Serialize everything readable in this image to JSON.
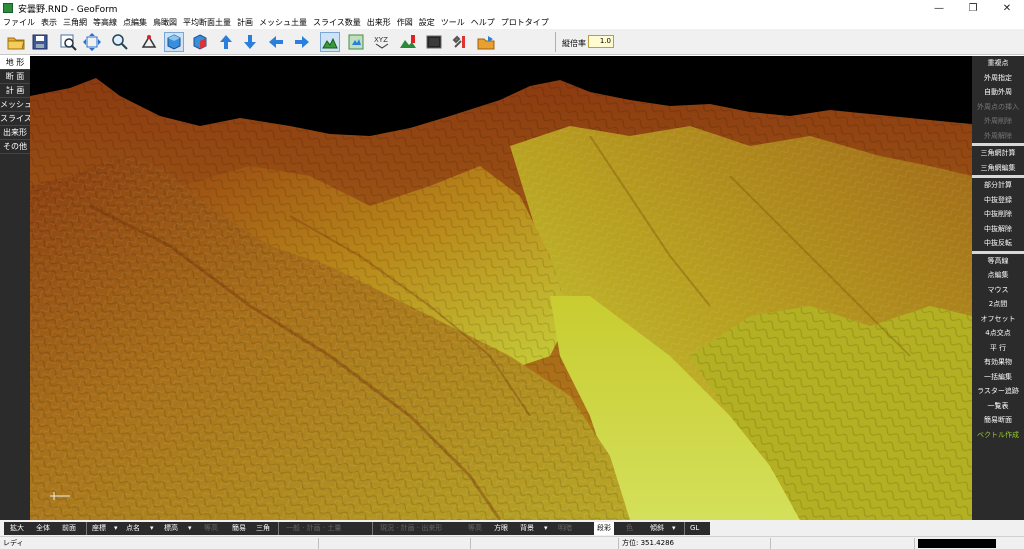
{
  "window": {
    "title": "安曇野.RND - GeoForm",
    "minimize": "—",
    "maximize": "❐",
    "close": "✕"
  },
  "menu": [
    "ファイル",
    "表示",
    "三角網",
    "等高線",
    "点編集",
    "鳥瞰図",
    "平均断面土量",
    "計画",
    "メッシュ土量",
    "スライス数量",
    "出来形",
    "作図",
    "設定",
    "ツール",
    "ヘルプ",
    "プロトタイプ"
  ],
  "toolbar": {
    "scale_label": "縦倍率",
    "scale_value": "1.0"
  },
  "left_panel": [
    "地 形",
    "断 面",
    "計 画",
    "メッシュ",
    "スライス",
    "出来形",
    "その他"
  ],
  "right_panel": {
    "group1": [
      "重複点",
      "外周指定",
      "自動外周",
      "外周点の挿入",
      "外周削除",
      "外周解除"
    ],
    "group2": [
      "三角網計算",
      "三角網編集"
    ],
    "group3": [
      "部分計算",
      "中抜登録",
      "中抜削除",
      "中抜解除",
      "中抜反転"
    ],
    "group4": [
      "等高線",
      "点編集",
      "マウス",
      "2点間",
      "オフセット",
      "4点交点",
      "平 行",
      "有効果物",
      "一括編集",
      "ラスター追跡",
      "一覧表",
      "簡易断面",
      "ベクトル作成"
    ]
  },
  "bottom_bar": {
    "zoom_in": "拡大",
    "whole": "全体",
    "previous": "前面",
    "coords": "座標",
    "point_name": "点名",
    "elevation": "標高",
    "disabled1": "等高",
    "simple": "簡易",
    "triangle": "三角",
    "disabled2": "一般 · 計画 · 土量",
    "disabled3": "現況 · 計画 · 出来形",
    "disabled4": "等高",
    "bearing": "方眼",
    "background": "背景",
    "disabled5": "明暗",
    "shading": "段彩",
    "disabled6": "色",
    "slope": "傾斜",
    "gl": "GL"
  },
  "status": {
    "ready": "レディ",
    "bearing_label": "方位:",
    "bearing_value": "351.4286"
  },
  "colors": {
    "panel_bg": "#2b2b2b",
    "terrain_high": "#8b3a10",
    "terrain_mid": "#b8861a",
    "terrain_low": "#c8d23a",
    "valley": "#d4e05a"
  }
}
